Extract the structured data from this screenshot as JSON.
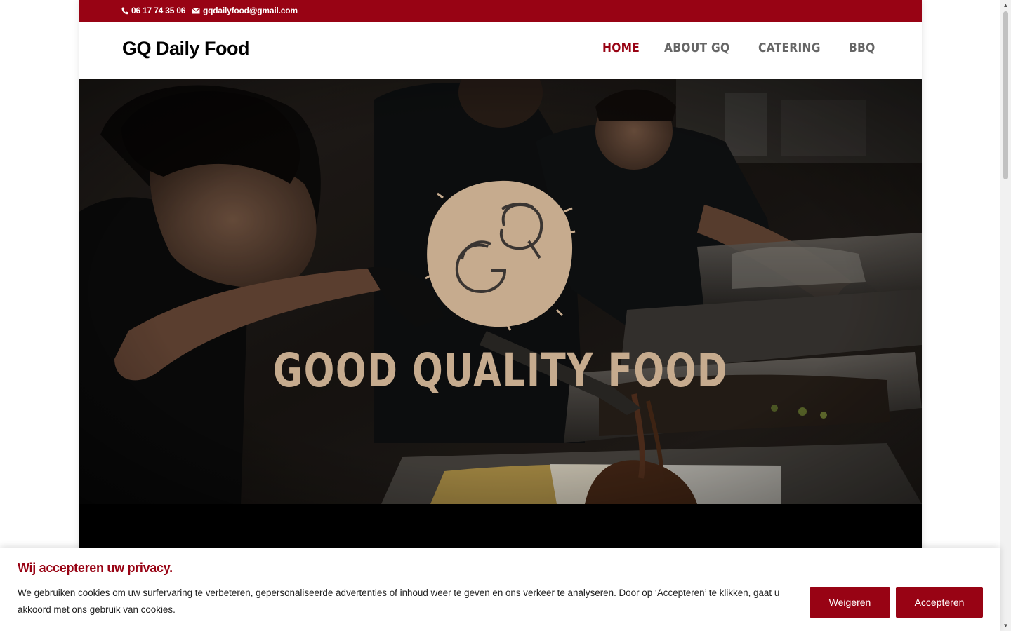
{
  "topbar": {
    "phone": "06 17 74 35 06",
    "email": "gqdailyfood@gmail.com"
  },
  "header": {
    "logo": "GQ Daily Food",
    "nav": [
      {
        "label": "HOME",
        "active": true
      },
      {
        "label": "ABOUT GQ",
        "active": false
      },
      {
        "label": "CATERING",
        "active": false
      },
      {
        "label": "BBQ",
        "active": false
      }
    ]
  },
  "hero": {
    "title": "GOOD QUALITY FOOD",
    "badge_color": "#c6ab8e",
    "badge_icon": "gq-monogram-logo"
  },
  "cookie": {
    "title": "Wij accepteren uw privacy.",
    "text": "We gebruiken cookies om uw surfervaring te verbeteren, gepersonaliseerde advertenties of inhoud weer te geven en ons verkeer te analyseren. Door op ‘Accepteren’ te klikken, gaat u akkoord met ons gebruik van cookies.",
    "decline": "Weigeren",
    "accept": "Accepteren"
  },
  "colors": {
    "brand": "#980314",
    "accent": "#c6ab8e"
  }
}
